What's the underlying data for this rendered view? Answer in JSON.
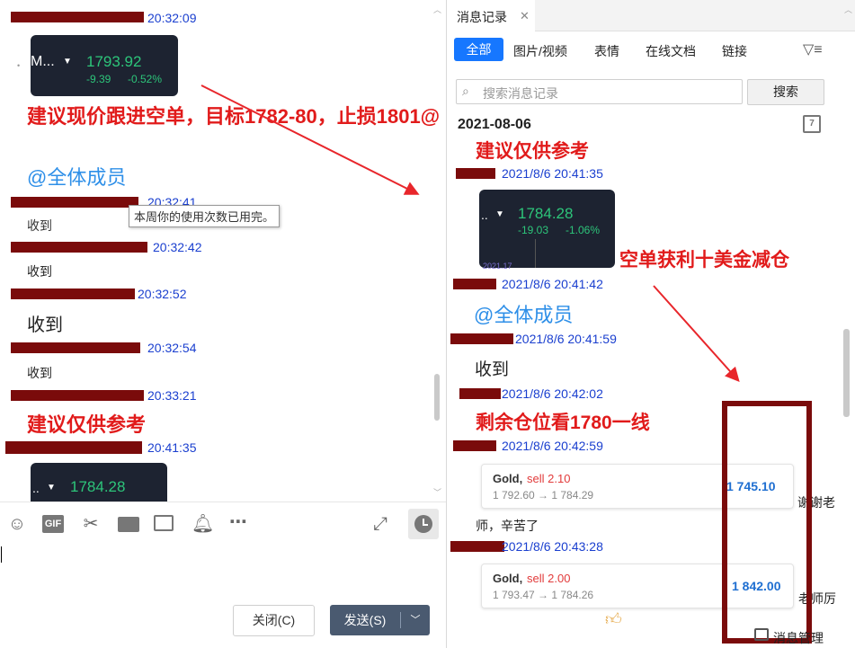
{
  "left_chat": {
    "times": [
      "20:32:09",
      "20:32:41",
      "20:32:42",
      "20:32:52",
      "20:32:54",
      "20:33:21",
      "20:41:35"
    ],
    "stock1": {
      "name": "M...",
      "price": "1793.92",
      "change": "-9.39",
      "pct": "-0.52%"
    },
    "advice": "建议现价跟进空单，目标1782-80，止损1801@",
    "mention": "@全体成员",
    "tooltip": "本周你的使用次数已用完。",
    "received": "收到",
    "advice2": "建议仅供参考",
    "stock2": {
      "price": "1784.28"
    }
  },
  "input_toolbar": {
    "close_label": "关闭(C)",
    "send_label": "发送(S)"
  },
  "history": {
    "tab_title": "消息记录",
    "filters": [
      "全部",
      "图片/视频",
      "表情",
      "在线文档",
      "链接"
    ],
    "search_placeholder": "搜索消息记录",
    "search_button": "搜索",
    "date": "2021-08-06",
    "advice": "建议仅供参考",
    "times": [
      "2021/8/6 20:41:35",
      "2021/8/6 20:41:42",
      "2021/8/6 20:41:59",
      "2021/8/6 20:42:02",
      "2021/8/6 20:42:59",
      "2021/8/6 20:43:28"
    ],
    "stock": {
      "price": "1784.28",
      "change": "-19.03",
      "pct": "-1.06%",
      "time": "2021.17"
    },
    "profit_note": "空单获利十美金减仓",
    "mention": "@全体成员",
    "received": "收到",
    "remaining": "剩余仓位看1780一线",
    "gold1": {
      "label": "Gold,",
      "action": "sell 2.10",
      "range": "1 792.60 → 1 784.29",
      "total": "1 745.10",
      "trail": "谢谢老"
    },
    "thanks": "师，辛苦了",
    "gold2": {
      "label": "Gold,",
      "action": "sell 2.00",
      "range": "1 793.47 → 1 784.26",
      "total": "1 842.00",
      "trail": "老师厉"
    },
    "manage": "消息管理"
  }
}
